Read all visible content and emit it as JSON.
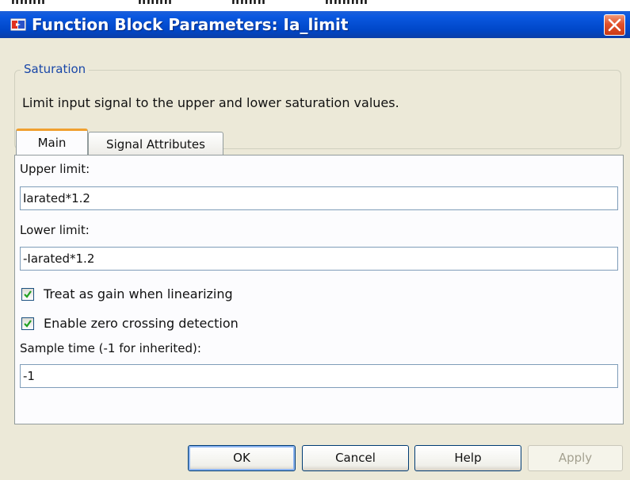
{
  "top_sliver": {
    "fragments": [
      "nnnn",
      "nnnn",
      "nnnn",
      "nnnnn"
    ]
  },
  "window": {
    "title": "Function Block Parameters: Ia_limit"
  },
  "block": {
    "name": "Saturation",
    "description": "Limit input signal to the upper and lower saturation values."
  },
  "tabs": [
    {
      "label": "Main",
      "active": true
    },
    {
      "label": "Signal Attributes",
      "active": false
    }
  ],
  "fields": {
    "upper_limit": {
      "label": "Upper limit:",
      "value": "Iarated*1.2"
    },
    "lower_limit": {
      "label": "Lower limit:",
      "value": "-Iarated*1.2"
    },
    "sample_time": {
      "label": "Sample time (-1 for inherited):",
      "value": "-1"
    }
  },
  "checkboxes": {
    "treat_as_gain": {
      "label": "Treat as gain when linearizing",
      "checked": true
    },
    "zero_crossing": {
      "label": "Enable zero crossing detection",
      "checked": true
    }
  },
  "buttons": {
    "ok": "OK",
    "cancel": "Cancel",
    "help": "Help",
    "apply": "Apply"
  },
  "colors": {
    "titlebar": "#0a58e0",
    "legend": "#1947a8",
    "checkmark": "#21a121",
    "close": "#e2512b"
  }
}
